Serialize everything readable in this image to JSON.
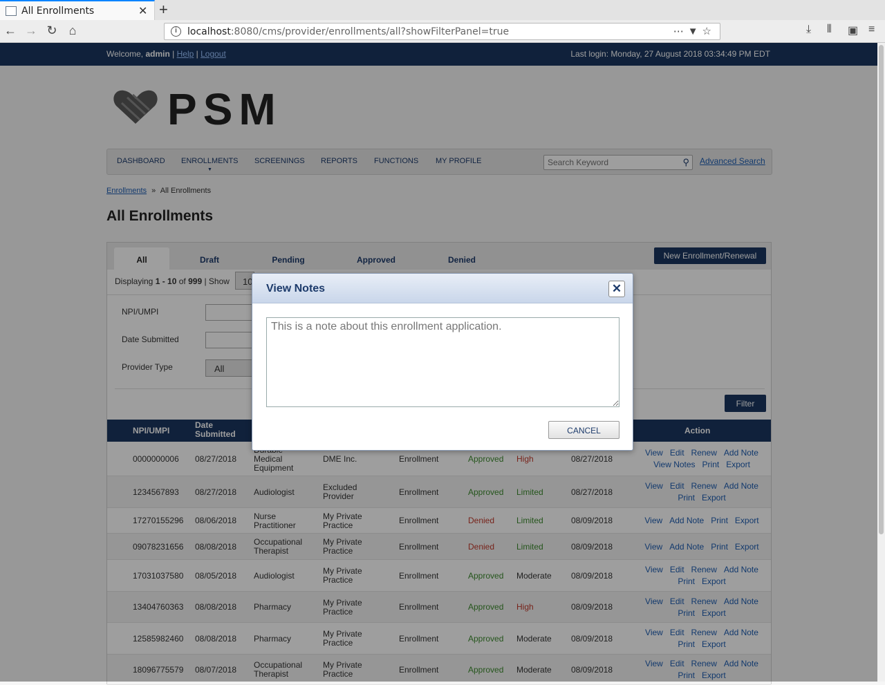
{
  "browser": {
    "tab_title": "All Enrollments",
    "url_host": "localhost",
    "url_rest": ":8080/cms/provider/enrollments/all?showFilterPanel=true"
  },
  "topbar": {
    "welcome": "Welcome,",
    "user": "admin",
    "help": "Help",
    "logout": "Logout",
    "last_login": "Last login: Monday, 27 August 2018 03:34:49 PM EDT"
  },
  "logo": {
    "text": "PSM"
  },
  "nav": {
    "items": [
      "DASHBOARD",
      "ENROLLMENTS",
      "SCREENINGS",
      "REPORTS",
      "FUNCTIONS",
      "MY PROFILE"
    ],
    "search_placeholder": "Search Keyword",
    "advanced_search": "Advanced Search"
  },
  "breadcrumb": {
    "link": "Enrollments",
    "sep": "»",
    "current": "All Enrollments"
  },
  "page_title": "All Enrollments",
  "tabs": [
    "All",
    "Draft",
    "Pending",
    "Approved",
    "Denied"
  ],
  "new_enrollment": "New Enrollment/Renewal",
  "display": {
    "prefix": "Displaying",
    "range": "1 - 10",
    "of": "of",
    "total": "999",
    "show": "| Show",
    "show_value": "10"
  },
  "filters": {
    "npi_label": "NPI/UMPI",
    "date_label": "Date Submitted",
    "type_label": "Provider Type",
    "type_value": "All",
    "filter_button": "Filter"
  },
  "table": {
    "headers": {
      "npi": "NPI/UMPI",
      "date_submitted": "Date\nSubmitted",
      "action": "Action"
    },
    "rows": [
      {
        "npi": "0000000006",
        "date": "08/27/2018",
        "type": "Durable\nMedical\nEquipment",
        "name": "DME Inc.",
        "request": "Enrollment",
        "status": "Approved",
        "risk": "High",
        "updated": "08/27/2018",
        "actions": [
          "View",
          "Edit",
          "Renew",
          "Add Note",
          "View Notes",
          "Print",
          "Export"
        ]
      },
      {
        "npi": "1234567893",
        "date": "08/27/2018",
        "type": "Audiologist",
        "name": "Excluded\nProvider",
        "request": "Enrollment",
        "status": "Approved",
        "risk": "Limited",
        "updated": "08/27/2018",
        "actions": [
          "View",
          "Edit",
          "Renew",
          "Add Note",
          "Print",
          "Export"
        ]
      },
      {
        "npi": "17270155296",
        "date": "08/06/2018",
        "type": "Nurse\nPractitioner",
        "name": "My Private\nPractice",
        "request": "Enrollment",
        "status": "Denied",
        "risk": "Limited",
        "updated": "08/09/2018",
        "actions": [
          "View",
          "Add Note",
          "Print",
          "Export"
        ]
      },
      {
        "npi": "09078231656",
        "date": "08/08/2018",
        "type": "Occupational\nTherapist",
        "name": "My Private\nPractice",
        "request": "Enrollment",
        "status": "Denied",
        "risk": "Limited",
        "updated": "08/09/2018",
        "actions": [
          "View",
          "Add Note",
          "Print",
          "Export"
        ]
      },
      {
        "npi": "17031037580",
        "date": "08/05/2018",
        "type": "Audiologist",
        "name": "My Private\nPractice",
        "request": "Enrollment",
        "status": "Approved",
        "risk": "Moderate",
        "updated": "08/09/2018",
        "actions": [
          "View",
          "Edit",
          "Renew",
          "Add Note",
          "Print",
          "Export"
        ]
      },
      {
        "npi": "13404760363",
        "date": "08/08/2018",
        "type": "Pharmacy",
        "name": "My Private\nPractice",
        "request": "Enrollment",
        "status": "Approved",
        "risk": "High",
        "updated": "08/09/2018",
        "actions": [
          "View",
          "Edit",
          "Renew",
          "Add Note",
          "Print",
          "Export"
        ]
      },
      {
        "npi": "12585982460",
        "date": "08/08/2018",
        "type": "Pharmacy",
        "name": "My Private\nPractice",
        "request": "Enrollment",
        "status": "Approved",
        "risk": "Moderate",
        "updated": "08/09/2018",
        "actions": [
          "View",
          "Edit",
          "Renew",
          "Add Note",
          "Print",
          "Export"
        ]
      },
      {
        "npi": "18096775579",
        "date": "08/07/2018",
        "type": "Occupational\nTherapist",
        "name": "My Private\nPractice",
        "request": "Enrollment",
        "status": "Approved",
        "risk": "Moderate",
        "updated": "08/09/2018",
        "actions": [
          "View",
          "Edit",
          "Renew",
          "Add Note",
          "Print",
          "Export"
        ]
      }
    ]
  },
  "modal": {
    "title": "View Notes",
    "note": "This is a note about this enrollment application.",
    "cancel": "CANCEL"
  },
  "colors": {
    "navy": "#1a3660",
    "approved": "#3c8a2e",
    "denied": "#c0392b",
    "link": "#1d5cb0"
  }
}
